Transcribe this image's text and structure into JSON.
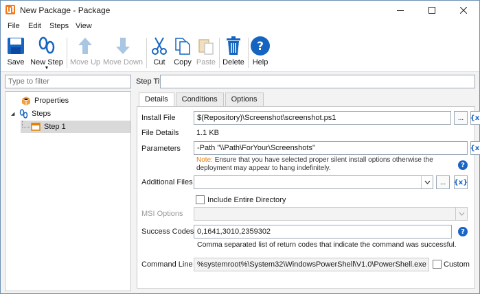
{
  "window": {
    "title": "New Package - Package"
  },
  "menu": {
    "items": [
      "File",
      "Edit",
      "Steps",
      "View"
    ]
  },
  "toolbar": {
    "save": "Save",
    "new_step": "New Step",
    "move_up": "Move Up",
    "move_down": "Move Down",
    "cut": "Cut",
    "copy": "Copy",
    "paste": "Paste",
    "delete": "Delete",
    "help": "Help"
  },
  "left": {
    "filter_placeholder": "Type to filter",
    "tree": {
      "properties": "Properties",
      "steps": "Steps",
      "step1": "Step 1"
    }
  },
  "right": {
    "step_title_label": "Step Title",
    "step_title_value": "",
    "tabs": [
      "Details",
      "Conditions",
      "Options"
    ],
    "details": {
      "install_file_label": "Install File",
      "install_file_value": "$(Repository)\\Screenshot\\screenshot.ps1",
      "file_details_label": "File Details",
      "file_details_value": "1.1 KB",
      "parameters_label": "Parameters",
      "parameters_value": "-Path \"\\\\Path\\ForYour\\Screenshots\"",
      "note_label": "Note:",
      "note_text_line1": "Ensure that you have selected proper silent install options otherwise the",
      "note_text_line2": "deployment may appear to hang indefinitely.",
      "additional_files_label": "Additional Files",
      "additional_files_value": "",
      "include_dir_label": "Include Entire Directory",
      "msi_options_label": "MSI Options",
      "success_codes_label": "Success Codes",
      "success_codes_value": "0,1641,3010,2359302",
      "success_codes_hint": "Comma separated list of return codes that indicate the command was successful.",
      "command_line_label": "Command Line",
      "command_line_value": "%systemroot%\\System32\\WindowsPowerShell\\V1.0\\PowerShell.exe -Nc",
      "custom_label": "Custom",
      "browse_label": "...",
      "var_label": "{x}",
      "help_label": "?"
    }
  },
  "colors": {
    "accent": "#1a64c8",
    "brand_orange": "#e67e00",
    "window_border": "#6b8fb3"
  }
}
